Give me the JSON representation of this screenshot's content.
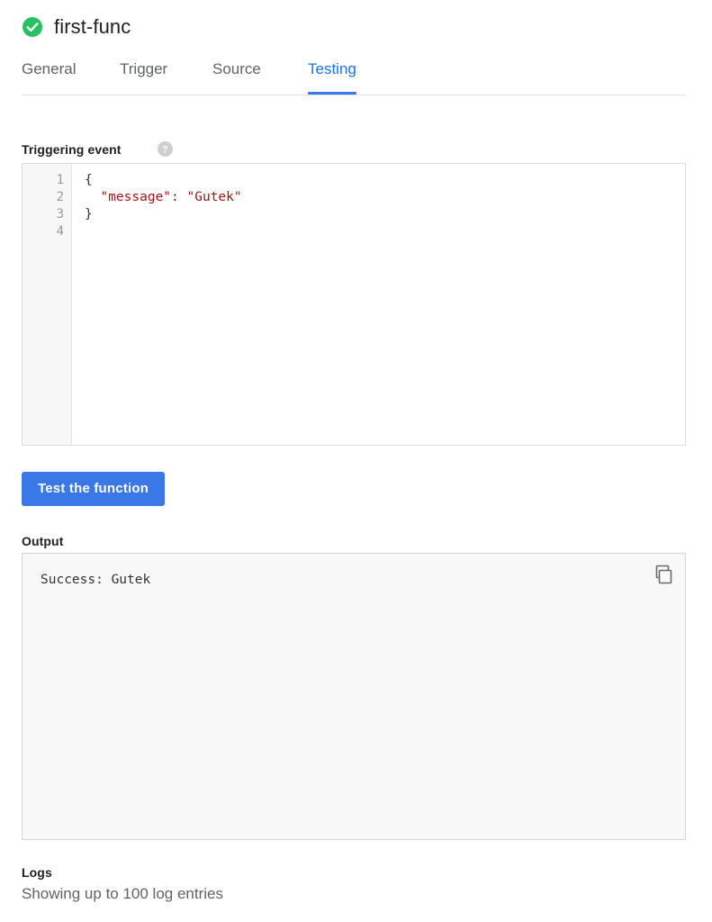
{
  "header": {
    "status_icon": "check-circle-icon",
    "status_color": "#25c162",
    "title": "first-func"
  },
  "tabs": [
    {
      "label": "General",
      "active": false
    },
    {
      "label": "Trigger",
      "active": false
    },
    {
      "label": "Source",
      "active": false
    },
    {
      "label": "Testing",
      "active": true
    }
  ],
  "accent_color": "#3b78e7",
  "triggering_event": {
    "label": "Triggering event",
    "help_icon": "help-circle-icon",
    "line_numbers": [
      "1",
      "2",
      "3",
      "4"
    ],
    "code_lines": [
      {
        "indent": "",
        "tokens": [
          {
            "text": "{",
            "type": "punct"
          }
        ]
      },
      {
        "indent": "  ",
        "tokens": [
          {
            "text": "\"message\"",
            "type": "key"
          },
          {
            "text": ":",
            "type": "punct"
          },
          {
            "text": " ",
            "type": "punct"
          },
          {
            "text": "\"Gutek\"",
            "type": "str"
          }
        ]
      },
      {
        "indent": "",
        "tokens": [
          {
            "text": "}",
            "type": "punct"
          }
        ]
      },
      {
        "indent": "",
        "tokens": []
      }
    ],
    "code_plain": "{\n    \"message\": \"Gutek\"\n}\n"
  },
  "test_button": {
    "label": "Test the function"
  },
  "output": {
    "label": "Output",
    "text": "Success: Gutek",
    "copy_icon": "copy-icon"
  },
  "logs": {
    "label": "Logs",
    "subtitle": "Showing up to 100 log entries"
  }
}
